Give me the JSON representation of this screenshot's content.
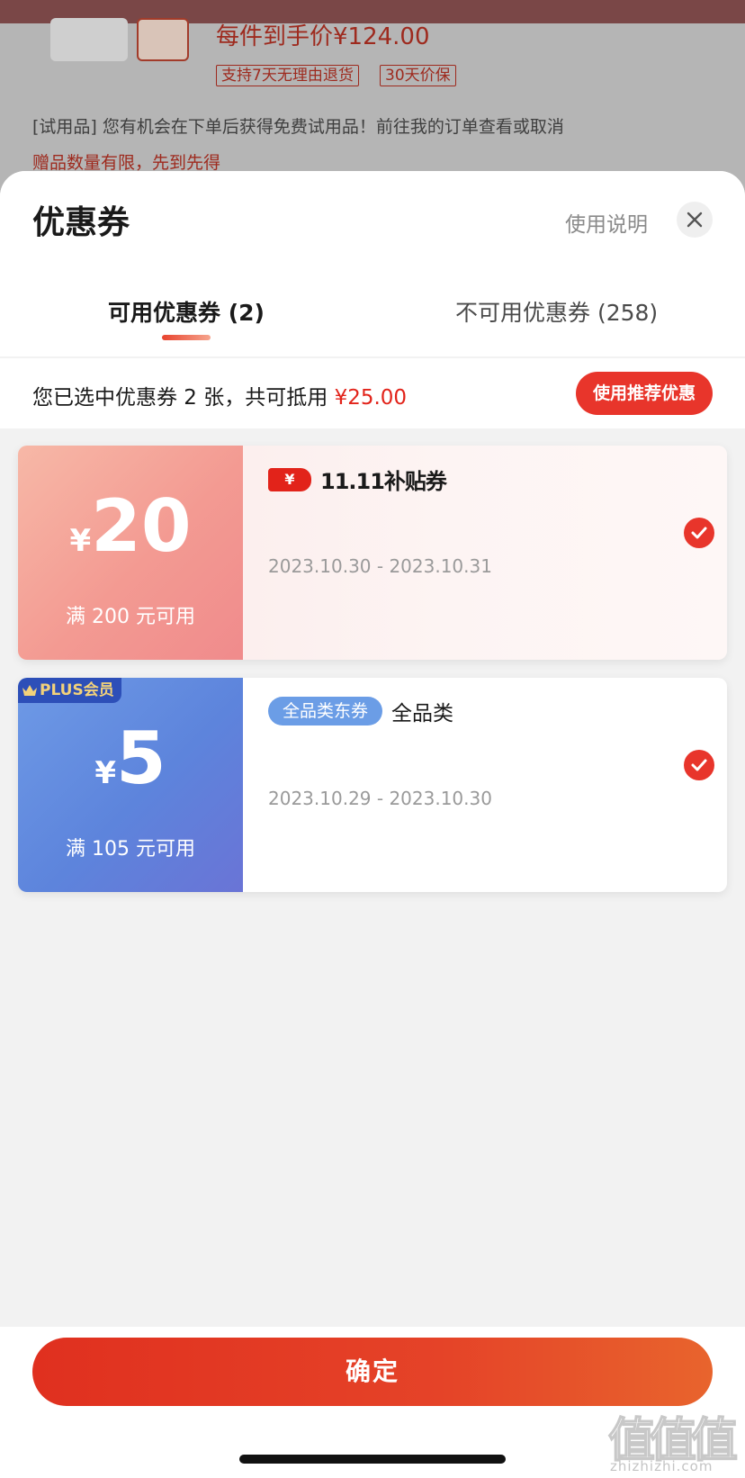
{
  "background": {
    "price_text": "每件到手价¥124.00",
    "tags": [
      "支持7天无理由退货",
      "30天价保"
    ],
    "note": "[试用品] 您有机会在下单后获得免费试用品！前往我的订单查看或取消",
    "warning": "赠品数量有限，先到先得"
  },
  "sheet": {
    "title": "优惠券",
    "help_label": "使用说明",
    "close_icon": "close-icon"
  },
  "tabs": {
    "available": "可用优惠券 (2)",
    "unavailable": "不可用优惠券 (258)",
    "active": "available"
  },
  "summary": {
    "prefix": "您已选中优惠券 2 张，共可抵用 ",
    "amount": "¥25.00",
    "recommend_button": "使用推荐优惠"
  },
  "coupons": [
    {
      "currency": "¥",
      "value": "20",
      "min_spend": "满 200 元可用",
      "badge": "¥",
      "name": "11.11补贴券",
      "date_range": "2023.10.30 - 2023.10.31",
      "selected": true
    },
    {
      "plus_badge": "PLUS会员",
      "currency": "¥",
      "value": "5",
      "min_spend": "满 105 元可用",
      "category_tag": "全品类东券",
      "name": "全品类",
      "date_range": "2023.10.29 - 2023.10.30",
      "selected": true
    }
  ],
  "footer": {
    "confirm_button": "确定"
  },
  "watermark": {
    "glyphs": [
      "值",
      "值",
      "值"
    ],
    "site": "zhizhizhi.com"
  },
  "colors": {
    "accent_red": "#e8352b",
    "price_red": "#e2231a",
    "plus_blue": "#5d84dc"
  }
}
